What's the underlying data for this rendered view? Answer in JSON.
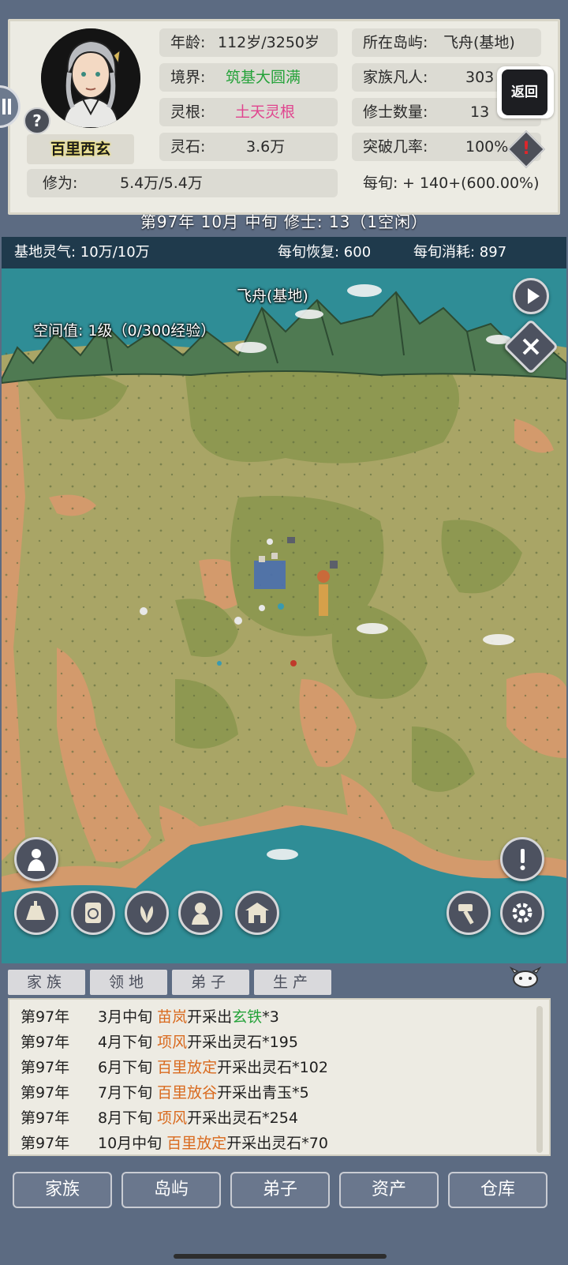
{
  "character": {
    "name": "百里西玄",
    "age_label": "年龄:",
    "age_value": "112岁/3250岁",
    "realm_label": "境界:",
    "realm_value": "筑基大圆满",
    "spirit_root_label": "灵根:",
    "spirit_root_value": "土天灵根",
    "spirit_stones_label": "灵石:",
    "spirit_stones_value": "3.6万",
    "cultivation_label": "修为:",
    "cultivation_value": "5.4万/5.4万",
    "per_period_label": "每旬:",
    "per_period_value": "+ 140+(600.00%)"
  },
  "island": {
    "location_label": "所在岛屿:",
    "location_value": "飞舟(基地)",
    "mortals_label": "家族凡人:",
    "mortals_value": "303",
    "cultivators_label": "修士数量:",
    "cultivators_value": "13",
    "breakthrough_label": "突破几率:",
    "breakthrough_value": "100%"
  },
  "buttons": {
    "return_label": "返回",
    "help_glyph": "?",
    "warn_glyph": "!"
  },
  "date_bar": "第97年 10月 中旬   修士: 13（1空闲）",
  "map": {
    "qi_label": "基地灵气: 10万/10万",
    "recovery_label": "每旬恢复: 600",
    "consumption_label": "每旬消耗: 897",
    "location_name": "飞舟(基地)",
    "space_value": "空间值: 1级（0/300经验）"
  },
  "log_tabs": [
    "家族",
    "领地",
    "弟子",
    "生产"
  ],
  "log": [
    {
      "year": "第97年",
      "time": "3月中旬",
      "person": "苗岚",
      "action": "开采出",
      "item": "玄铁",
      "qty": "*3"
    },
    {
      "year": "第97年",
      "time": "4月下旬",
      "person": "项风",
      "action": "开采出灵石*195",
      "item": "",
      "qty": ""
    },
    {
      "year": "第97年",
      "time": "6月下旬",
      "person": "百里放定",
      "action": "开采出灵石*102",
      "item": "",
      "qty": ""
    },
    {
      "year": "第97年",
      "time": "7月下旬",
      "person": "百里放谷",
      "action": "开采出青玉*5",
      "item": "",
      "qty": ""
    },
    {
      "year": "第97年",
      "time": "8月下旬",
      "person": "项风",
      "action": "开采出灵石*254",
      "item": "",
      "qty": ""
    },
    {
      "year": "第97年",
      "time": "10月中旬",
      "person": "百里放定",
      "action": "开采出灵石*70",
      "item": "",
      "qty": ""
    }
  ],
  "bottom_nav": [
    "家族",
    "岛屿",
    "弟子",
    "资产",
    "仓库"
  ],
  "colors": {
    "frame": "#5c6b82",
    "panel": "#ecebe3",
    "green_text": "#25a23a",
    "pink_text": "#e0458f",
    "orange_text": "#d96a1e",
    "map_top": "#1f3a4c"
  }
}
